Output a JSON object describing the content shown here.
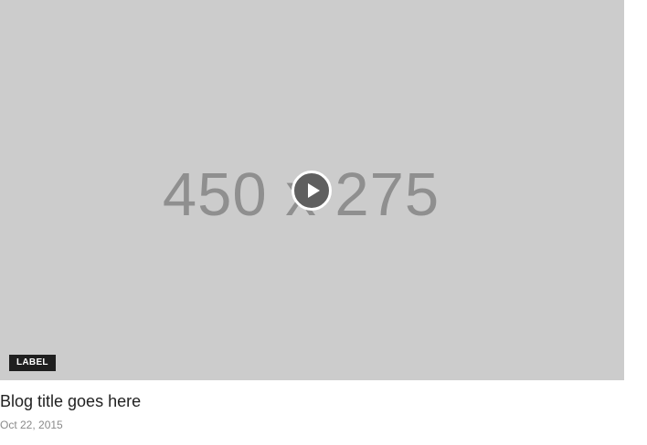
{
  "media": {
    "placeholder_text": "450 x 275",
    "badge_label": "LABEL",
    "play_icon": "play-icon",
    "background_color": "#cccccc"
  },
  "post": {
    "title": "Blog title goes here",
    "date": "Oct 22, 2015"
  }
}
